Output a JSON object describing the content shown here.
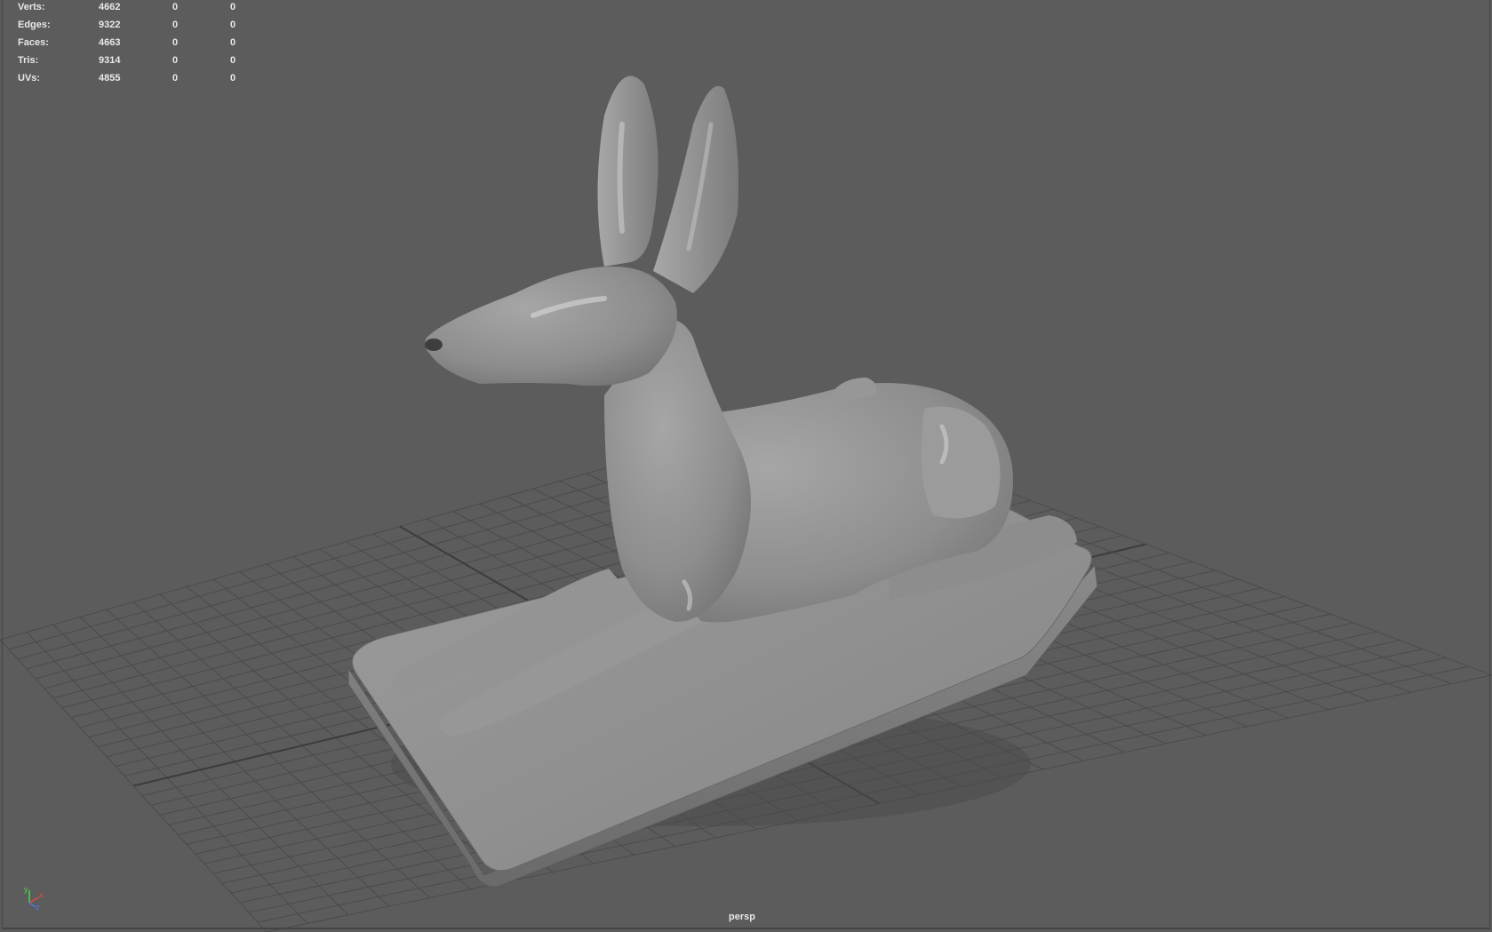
{
  "hud": {
    "rows": [
      {
        "label": "Verts:",
        "values": [
          "4662",
          "0",
          "0"
        ]
      },
      {
        "label": "Edges:",
        "values": [
          "9322",
          "0",
          "0"
        ]
      },
      {
        "label": "Faces:",
        "values": [
          "4663",
          "0",
          "0"
        ]
      },
      {
        "label": "Tris:",
        "values": [
          "9314",
          "0",
          "0"
        ]
      },
      {
        "label": "UVs:",
        "values": [
          "4855",
          "0",
          "0"
        ]
      }
    ]
  },
  "viewport": {
    "camera": "persp",
    "background_color": "#5c5c5c",
    "grid_color": "#4b4b4b",
    "model_color": "#8c8c8c"
  },
  "axis_gizmo": {
    "y_label": "y",
    "x_label": "x",
    "z_label": "z",
    "y_color": "#4fd34f",
    "x_color": "#e04a4a",
    "z_color": "#4a7ae0"
  }
}
